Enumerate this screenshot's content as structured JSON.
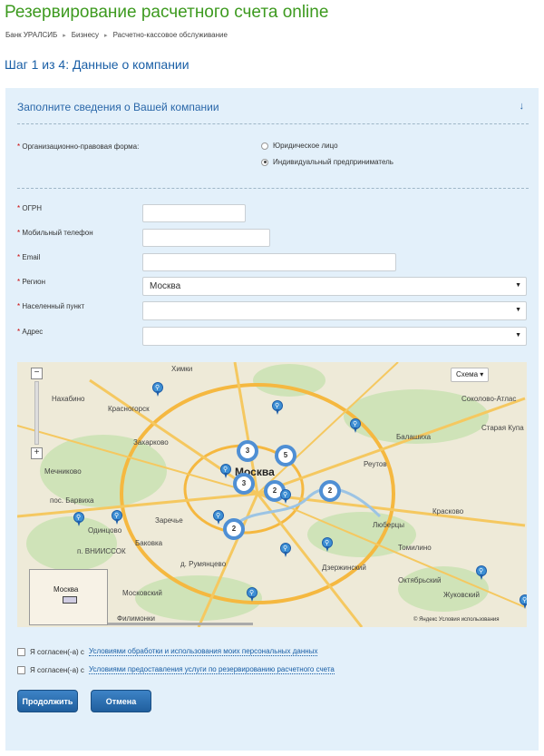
{
  "header": {
    "title": "Резервирование расчетного счета online",
    "breadcrumbs": [
      "Банк УРАЛСИБ",
      "Бизнесу",
      "Расчетно-кассовое обслуживание"
    ]
  },
  "step": {
    "title": "Шаг 1 из 4: Данные о компании"
  },
  "panel": {
    "header": "Заполните сведения о Вашей компании",
    "collapse_icon": "↓"
  },
  "form": {
    "legal_form_label": "Организационно-правовая форма:",
    "legal_form_options": [
      "Юридическое лицо",
      "Индивидуальный предприниматель"
    ],
    "legal_form_selected": "Индивидуальный предприниматель",
    "ogrn_label": "ОГРН",
    "ogrn_value": "",
    "phone_label": "Мобильный телефон",
    "phone_value": "",
    "email_label": "Email",
    "email_value": "",
    "region_label": "Регион",
    "region_value": "Москва",
    "city_label": "Населенный пункт",
    "city_value": "",
    "address_label": "Адрес",
    "address_value": "",
    "required_mark": "*"
  },
  "map": {
    "type_selector": "Схема ▾",
    "zoom_in": "+",
    "zoom_out": "−",
    "copyright": "© Яндекс  Условия использования",
    "minimap_label": "Москва",
    "clusters": [
      "3",
      "5",
      "3",
      "2",
      "2",
      "2"
    ],
    "labels": {
      "khimki": "Химки",
      "nakhabino": "Нахабино",
      "krasnogorsk": "Красногорск",
      "zakharkovo": "Захарково",
      "mechnikovo": "Мечниково",
      "odintsovo": "Одинцово",
      "moskva": "Москва",
      "balashikha": "Балашиха",
      "reutov": "Реутов",
      "lyubertsy": "Люберцы",
      "tomilino": "Томилино",
      "dzerzhinsky": "Дзержинский",
      "oktyabrsky": "Октябрьский",
      "zhukovsky": "Жуковский",
      "kraskovo": "Красково",
      "staraya_kupavna": "Старая Купа",
      "sokolovo": "Соколово-Атлас",
      "moskovsky": "Московский",
      "filimonki": "Филимонки",
      "rumyantsevo": "д. Румянцево",
      "vnukovo": "п. ВНИИССОК",
      "bakovka": "Баковка",
      "zarechye": "Заречье",
      "barvikha": "пос. Барвиха",
      "dzerzh": "Дзержинский"
    }
  },
  "agreements": {
    "prefix": "Я согласен(-а) с",
    "consent1_link": "Условиями обработки и использования моих персональных данных",
    "consent2_link": "Условиями предоставления услуги по резервированию расчетного счета"
  },
  "buttons": {
    "continue": "Продолжить",
    "cancel": "Отмена"
  },
  "colors": {
    "title_green": "#3d9a1f",
    "link_blue": "#1a5fa6",
    "panel_bg": "#e3f0fa",
    "button_blue": "#2a6fb1"
  }
}
